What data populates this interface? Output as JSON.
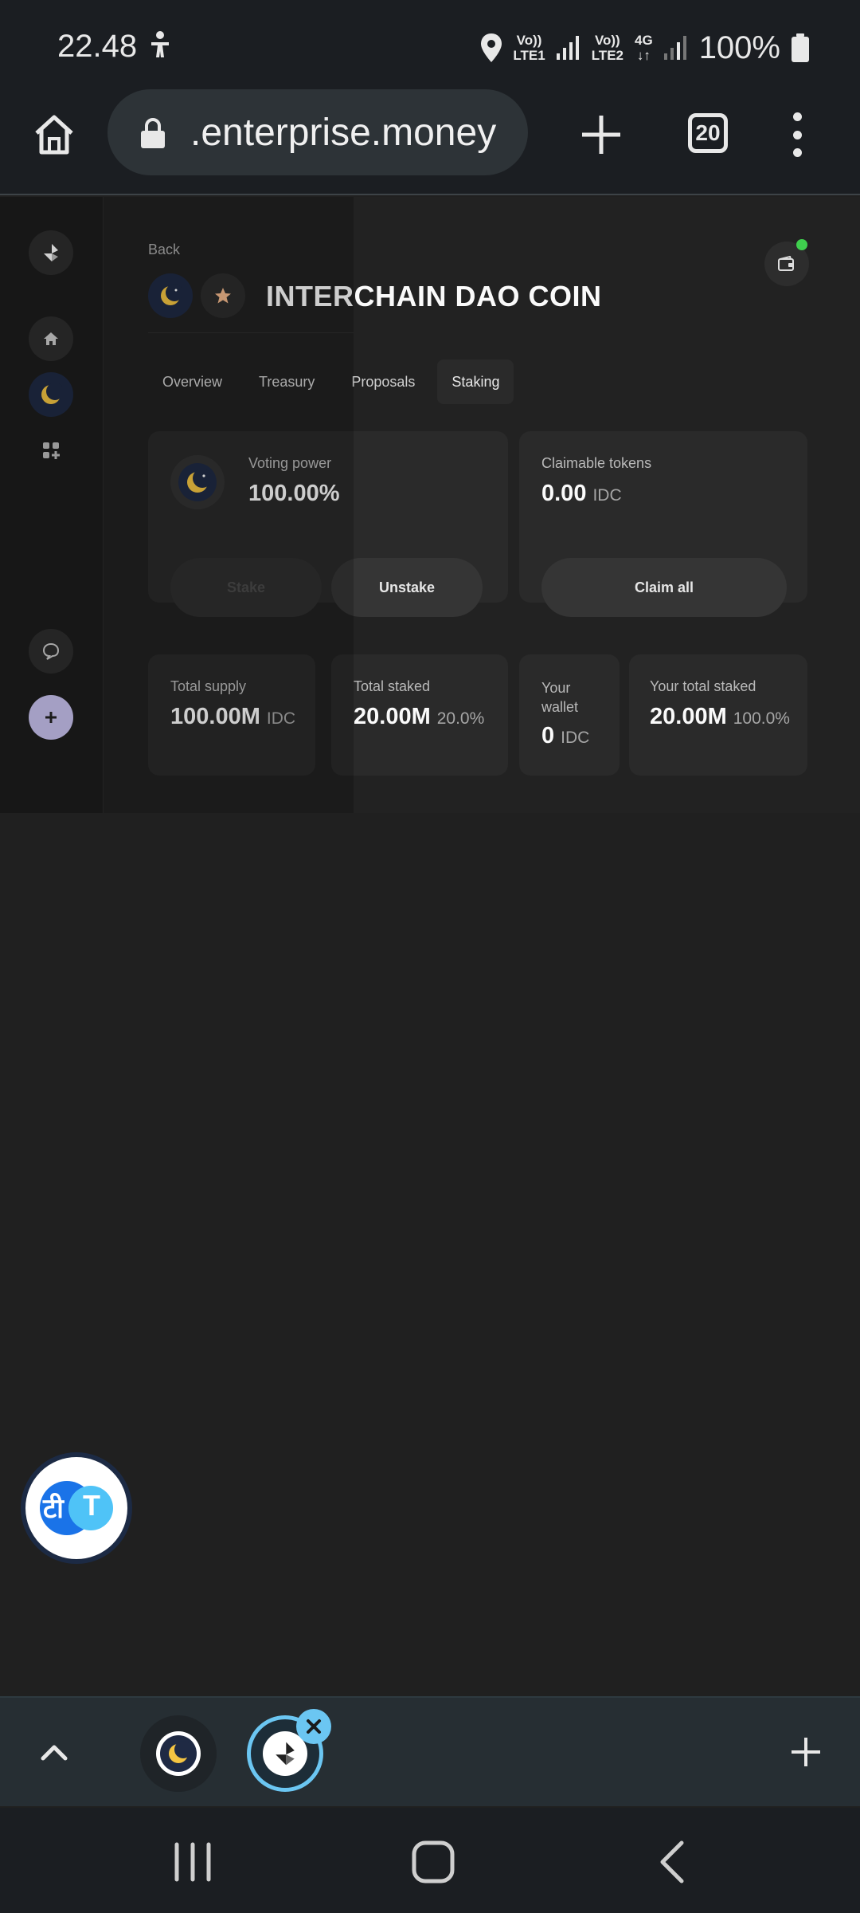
{
  "status_bar": {
    "time": "22.48",
    "sim1_label_top": "Vo))",
    "sim1_label_bottom": "LTE1",
    "sim2_label_top": "Vo))",
    "sim2_label_bottom": "LTE2",
    "data_label": "4G",
    "battery": "100%",
    "icons": [
      "accessibility-icon",
      "location-icon",
      "signal-icon",
      "battery-icon"
    ]
  },
  "browser": {
    "url": ".enterprise.money",
    "tab_count": "20",
    "icons": [
      "home-icon",
      "lock-icon",
      "plus-icon",
      "tabs-icon",
      "more-icon"
    ]
  },
  "dao": {
    "back_label": "Back",
    "title": "INTERCHAIN DAO COIN",
    "tabs": [
      {
        "label": "Overview"
      },
      {
        "label": "Treasury"
      },
      {
        "label": "Proposals"
      },
      {
        "label": "Staking",
        "active": true
      }
    ],
    "voting_card": {
      "label": "Voting power",
      "value": "100.00%",
      "stake_label": "Stake",
      "unstake_label": "Unstake"
    },
    "claim_card": {
      "label": "Claimable tokens",
      "value": "0.00",
      "unit": "IDC",
      "claim_label": "Claim all"
    },
    "stats": {
      "total_supply": {
        "label": "Total supply",
        "value": "100.00M",
        "unit": "IDC"
      },
      "total_staked": {
        "label": "Total staked",
        "value": "20.00M",
        "pct": "20.0%"
      },
      "your_wallet": {
        "label_line1": "Your",
        "label_line2": "wallet",
        "value": "0",
        "unit": "IDC"
      },
      "your_total_staked": {
        "label": "Your total staked",
        "value": "20.00M",
        "pct": "100.0%"
      }
    }
  },
  "translate_bubble": {
    "left_glyph": "टी",
    "right_glyph": "T"
  },
  "colors": {
    "accent_purple": "#c9c3f0",
    "online_green": "#3fcf4e",
    "active_tab_blue": "#6bc6f2",
    "moon_yellow": "#f5c542",
    "star_peach": "#f3b98c"
  }
}
